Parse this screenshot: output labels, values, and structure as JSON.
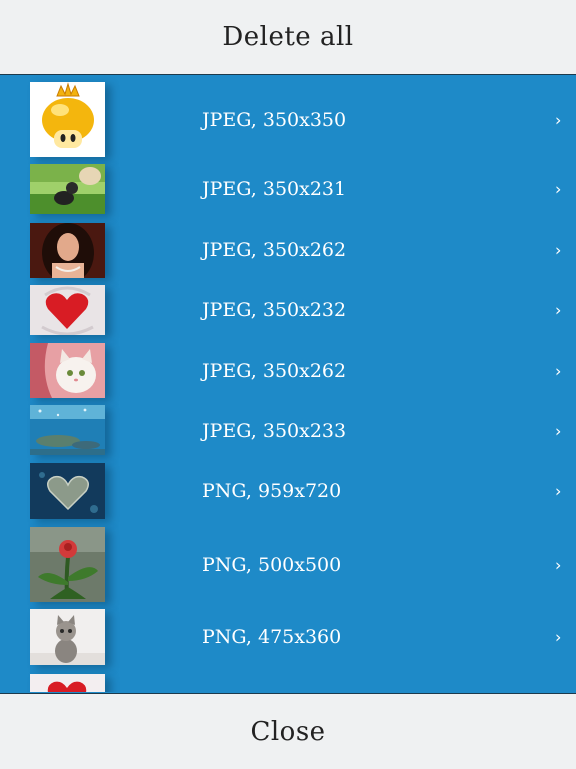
{
  "header": {
    "delete_all_label": "Delete all"
  },
  "footer": {
    "close_label": "Close"
  },
  "items": [
    {
      "label": "JPEG, 350x350",
      "thumb": "golden-mushroom-icon"
    },
    {
      "label": "JPEG, 350x231",
      "thumb": "puppy-and-cat-photo"
    },
    {
      "label": "JPEG, 350x262",
      "thumb": "woman-portrait-photo"
    },
    {
      "label": "JPEG, 350x232",
      "thumb": "red-heart-knit-photo"
    },
    {
      "label": "JPEG, 350x262",
      "thumb": "white-kitten-photo"
    },
    {
      "label": "JPEG, 350x233",
      "thumb": "underwater-turtle-photo"
    },
    {
      "label": "PNG, 959x720",
      "thumb": "heart-island-photo"
    },
    {
      "label": "PNG, 500x500",
      "thumb": "rose-plant-photo"
    },
    {
      "label": "PNG, 475x360",
      "thumb": "tabby-kitten-photo"
    },
    {
      "label": "",
      "thumb": "red-heart-photo"
    }
  ],
  "chevron_glyph": "›"
}
